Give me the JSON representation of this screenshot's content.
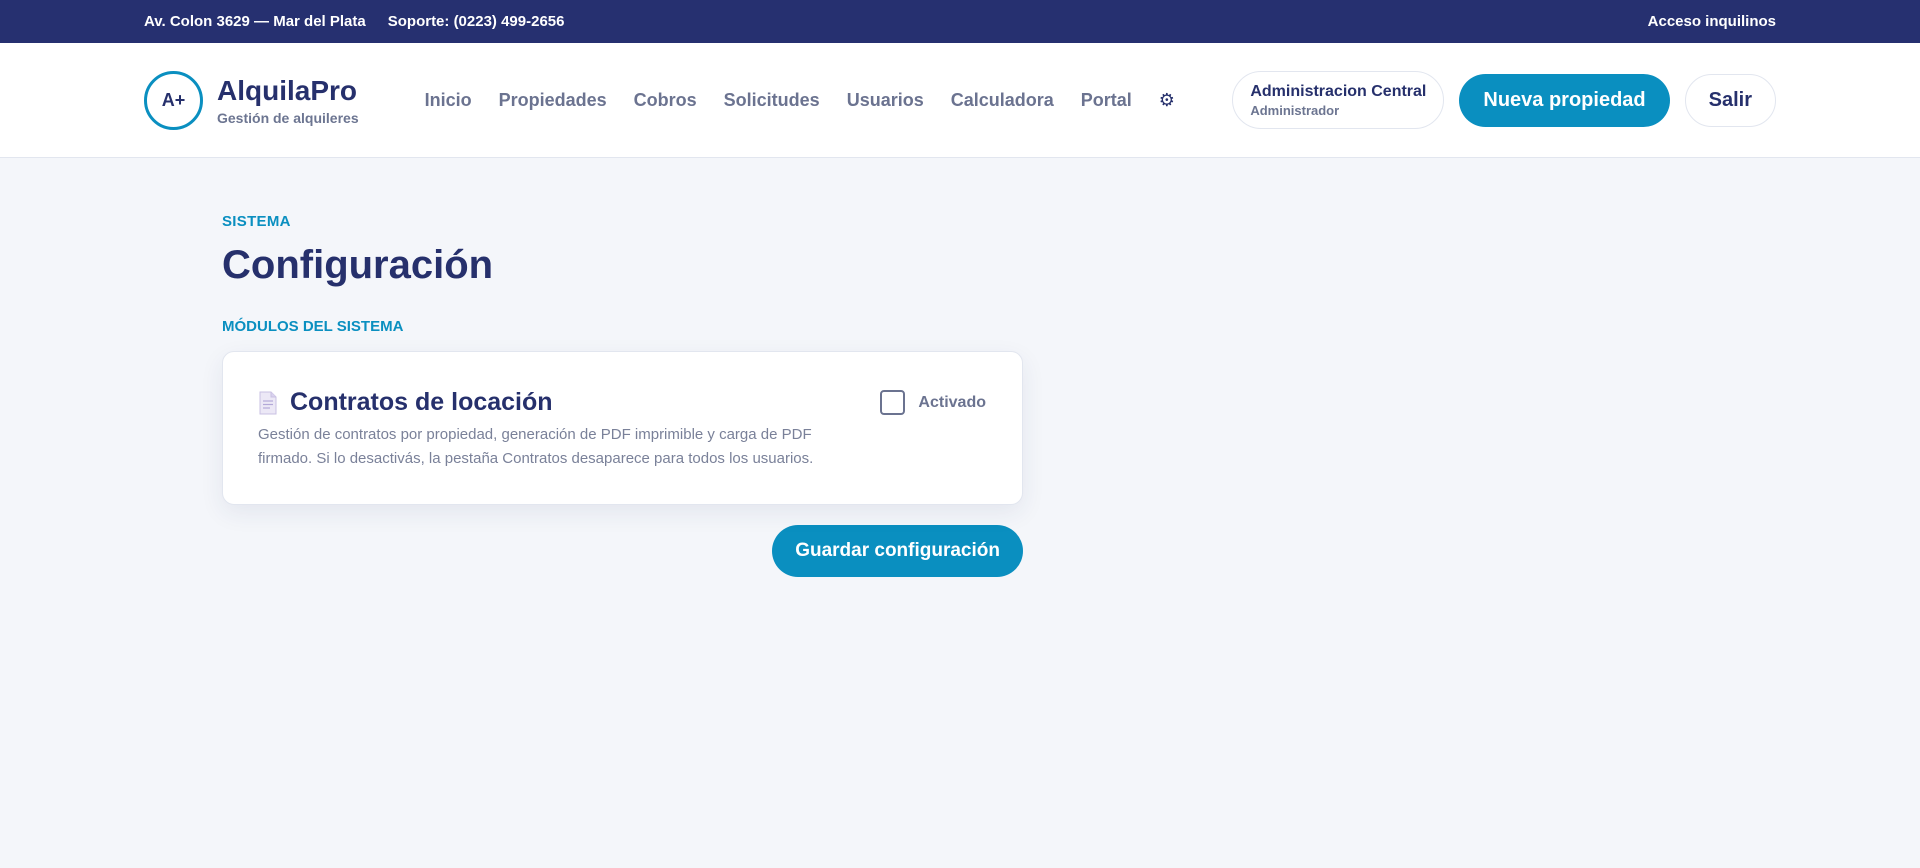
{
  "topbar": {
    "address": "Av. Colon 3629 — Mar del Plata",
    "support": "Soporte: (0223) 499-2656",
    "tenant_access": "Acceso inquilinos"
  },
  "brand": {
    "logo_text": "A+",
    "name": "AlquilaPro",
    "tagline": "Gestión de alquileres"
  },
  "nav": {
    "items": [
      {
        "label": "Inicio"
      },
      {
        "label": "Propiedades"
      },
      {
        "label": "Cobros"
      },
      {
        "label": "Solicitudes"
      },
      {
        "label": "Usuarios"
      },
      {
        "label": "Calculadora"
      },
      {
        "label": "Portal"
      }
    ],
    "settings_icon": "gear-icon",
    "settings_glyph": "⚙"
  },
  "user": {
    "name": "Administracion Central",
    "role": "Administrador"
  },
  "header_actions": {
    "new_property": "Nueva propiedad",
    "logout": "Salir"
  },
  "page": {
    "eyebrow": "SISTEMA",
    "title": "Configuración",
    "section_label": "MÓDULOS DEL SISTEMA"
  },
  "modules": [
    {
      "icon": "document-icon",
      "title": "Contratos de locación",
      "description": "Gestión de contratos por propiedad, generación de PDF imprimible y carga de PDF firmado. Si lo desactivás, la pestaña Contratos desaparece para todos los usuarios.",
      "toggle_label": "Activado",
      "enabled": false
    }
  ],
  "actions": {
    "save": "Guardar configuración"
  },
  "colors": {
    "navy": "#263070",
    "accent": "#0a8fc0",
    "background": "#f4f6fa",
    "muted_text": "#6b7390"
  }
}
